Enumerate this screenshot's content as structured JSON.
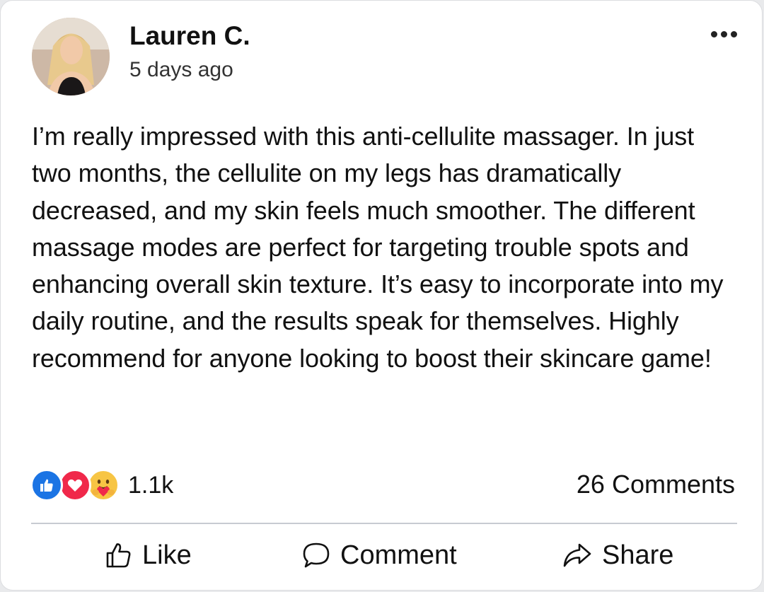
{
  "post": {
    "author_name": "Lauren C.",
    "timestamp": "5 days ago",
    "more_icon": "ellipsis-icon",
    "body": "I’m really impressed with this anti-cellulite massager. In just two months, the cellulite on my legs has dramatically decreased, and my skin feels much smoother. The different massage modes are perfect for targeting trouble spots and enhancing overall skin texture. It’s easy to incorporate into my daily routine, and the results speak for themselves. Highly recommend for anyone looking to boost their skincare game!"
  },
  "reactions": {
    "icons": [
      "like-reaction-icon",
      "love-reaction-icon",
      "care-reaction-icon"
    ],
    "count": "1.1k",
    "comments_count": "26 Comments"
  },
  "actions": {
    "like_label": "Like",
    "comment_label": "Comment",
    "share_label": "Share"
  },
  "colors": {
    "like_blue": "#1b74e4",
    "love_red": "#f0284a",
    "care_yellow": "#f7c544",
    "divider": "#c7cbd1"
  }
}
